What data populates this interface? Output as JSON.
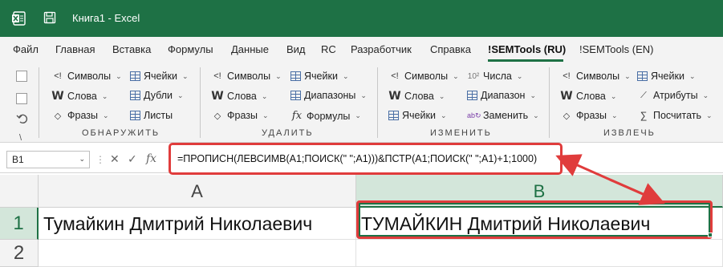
{
  "window": {
    "title": "Книга1 - Excel"
  },
  "menu": {
    "tabs": [
      {
        "label": "Файл"
      },
      {
        "label": "Главная"
      },
      {
        "label": "Вставка"
      },
      {
        "label": "Формулы"
      },
      {
        "label": "Данные"
      },
      {
        "label": "Вид"
      },
      {
        "label": "RC"
      },
      {
        "label": "Разработчик"
      },
      {
        "label": "Справка"
      },
      {
        "label": "!SEMTools (RU)"
      },
      {
        "label": "!SEMTools (EN)"
      }
    ],
    "active_tab": "!SEMTools (RU)"
  },
  "ribbon": {
    "groups": [
      {
        "label": "ОБНАРУЖИТЬ",
        "items": [
          {
            "label": "Символы",
            "icon": "symbols-icon"
          },
          {
            "label": "Ячейки",
            "icon": "cells-icon"
          },
          {
            "label": "Слова",
            "icon": "words-icon"
          },
          {
            "label": "Дубли",
            "icon": "duplicates-icon"
          },
          {
            "label": "Фразы",
            "icon": "phrases-icon"
          },
          {
            "label": "Листы",
            "icon": "sheets-icon"
          }
        ]
      },
      {
        "label": "УДАЛИТЬ",
        "items": [
          {
            "label": "Символы",
            "icon": "symbols-icon"
          },
          {
            "label": "Ячейки",
            "icon": "cells-icon"
          },
          {
            "label": "Слова",
            "icon": "words-icon"
          },
          {
            "label": "Диапазоны",
            "icon": "ranges-icon"
          },
          {
            "label": "Фразы",
            "icon": "phrases-icon"
          },
          {
            "label": "Формулы",
            "icon": "formulas-icon"
          }
        ]
      },
      {
        "label": "ИЗМЕНИТЬ",
        "items": [
          {
            "label": "Символы",
            "icon": "symbols-icon"
          },
          {
            "label": "Числа",
            "icon": "numbers-icon"
          },
          {
            "label": "Слова",
            "icon": "words-icon"
          },
          {
            "label": "Диапазон",
            "icon": "range-icon"
          },
          {
            "label": "Ячейки",
            "icon": "cells-icon"
          },
          {
            "label": "Заменить",
            "icon": "replace-icon"
          }
        ]
      },
      {
        "label": "ИЗВЛЕЧЬ",
        "items": [
          {
            "label": "Символы",
            "icon": "symbols-icon"
          },
          {
            "label": "Ячейки",
            "icon": "cells-icon"
          },
          {
            "label": "Слова",
            "icon": "words-icon"
          },
          {
            "label": "Атрибуты",
            "icon": "attributes-icon"
          },
          {
            "label": "Фразы",
            "icon": "phrases-icon"
          },
          {
            "label": "Посчитать",
            "icon": "count-icon"
          }
        ]
      }
    ]
  },
  "formula_bar": {
    "name_box": "B1",
    "formula": "=ПРОПИСН(ЛЕВСИМВ(A1;ПОИСК(\" \";A1)))&ПСТР(A1;ПОИСК(\" \";A1)+1;1000)"
  },
  "sheet": {
    "columns": [
      "A",
      "B"
    ],
    "rows": [
      "1",
      "2"
    ],
    "cells": {
      "A1": "Тумайкин Дмитрий Николаевич",
      "B1": "ТУМАЙКИН Дмитрий Николаевич"
    },
    "selected_cell": "B1"
  },
  "colors": {
    "accent": "#1e7145",
    "highlight": "#e03c3c"
  }
}
